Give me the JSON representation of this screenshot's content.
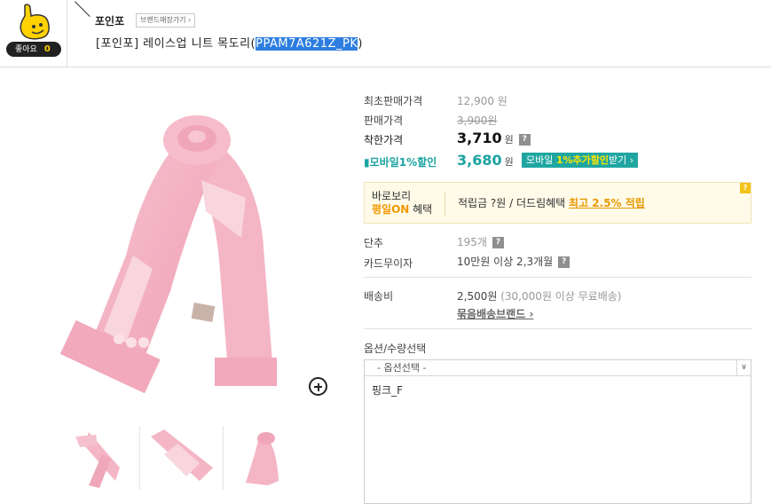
{
  "like": {
    "label": "좋아요",
    "count": "0"
  },
  "brand": {
    "name": "포인포",
    "button_label": "브랜드매장가기 ›"
  },
  "product": {
    "title_prefix": "[포인포] 레이스업 니트 목도리(",
    "code": "PPAM7A621Z_PK",
    "title_suffix": ")"
  },
  "prices": {
    "original_label": "최초판매가격",
    "original_value": "12,900 원",
    "sale_label": "판매가격",
    "sale_value": "3,900원",
    "good_label": "착한가격",
    "good_value": "3,710",
    "good_unit": "원",
    "mobile_label": "모바일1%할인",
    "mobile_value": "3,680",
    "mobile_unit": "원",
    "mobile_btn_prefix": "모바일 ",
    "mobile_btn_highlight": "1%추가할인",
    "mobile_btn_suffix": "받기 ›"
  },
  "benefit": {
    "line1": "바로보리",
    "line2_highlight": "평일ON",
    "line2_suffix": " 혜택",
    "text": "적립금 ?원 / 더드림혜택 ",
    "link": "최고 2.5% 적립"
  },
  "details": {
    "stock_label": "단추",
    "stock_value": "195개",
    "card_label": "카드무이자",
    "card_value": "10만원 이상 2,3개월",
    "ship_label": "배송비",
    "ship_value": "2,500원",
    "ship_note": " (30,000원 이상 무료배송)",
    "bundle_link": "묶음배송브랜드 ›"
  },
  "options": {
    "title": "옵션/수량선택",
    "select_placeholder": "- 옵션선택 -",
    "items": [
      "핑크_F"
    ]
  },
  "colors": {
    "accent_teal": "#1fa6a1",
    "highlight_blue": "#2d7ee0",
    "benefit_orange": "#f39800"
  }
}
